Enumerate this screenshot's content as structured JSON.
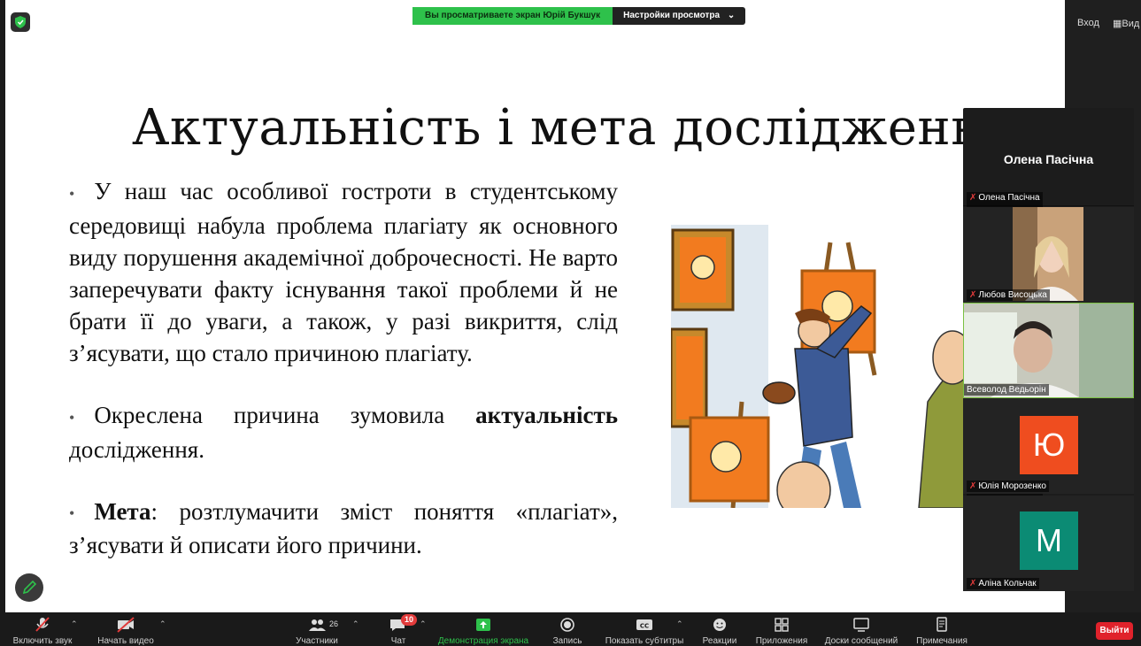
{
  "banner": {
    "viewing_text": "Вы просматриваете экран Юрій Букшук",
    "settings_label": "Настройки просмотра"
  },
  "top_right": {
    "enter_label": "Вход",
    "view_label": "Вид"
  },
  "slide": {
    "title": "Актуальність і мета дослідження",
    "p1": "У наш час особливої гостроти в студентському середовищі набула проблема плагіату як основного виду порушення академічної доброчесності. Не варто заперечувати факту існування такої проблеми й не брати її до уваги, а також, у разі викриття, слід з’ясувати, що стало причиною плагіату.",
    "p2_before": "Окреслена причина зумовила ",
    "p2_bold": "актуальність",
    "p2_after": " дослідження.",
    "p3_bold": "Мета",
    "p3_after": ": розтлумачити зміст поняття «плагіат», з’ясувати й описати його причини.",
    "bullet": "•"
  },
  "video_panel": {
    "active_speaker": "Олена Пасічна",
    "participants": [
      {
        "name": "Олена Пасічна"
      },
      {
        "name": "Любов Висоцька"
      },
      {
        "name": "Всеволод Ведьорін"
      },
      {
        "name": "Юлія Морозенко",
        "initial": "Ю"
      },
      {
        "name": "Аліна Кольчак",
        "initial": "М"
      }
    ]
  },
  "colors": {
    "share_green": "#2ec14b",
    "avatar_orange": "#ef4d1f",
    "avatar_teal": "#0b8b74",
    "leave_red": "#e0222b",
    "muted_red": "#e23b3b"
  },
  "toolbar": {
    "mute_label": "Включить звук",
    "video_label": "Начать видео",
    "participants_label": "Участники",
    "participants_count": "26",
    "chat_label": "Чат",
    "chat_badge": "10",
    "share_label": "Демонстрация экрана",
    "record_label": "Запись",
    "captions_label": "Показать субтитры",
    "reactions_label": "Реакции",
    "apps_label": "Приложения",
    "whiteboards_label": "Доски сообщений",
    "notes_label": "Примечания",
    "leave_label": "Выйти"
  }
}
